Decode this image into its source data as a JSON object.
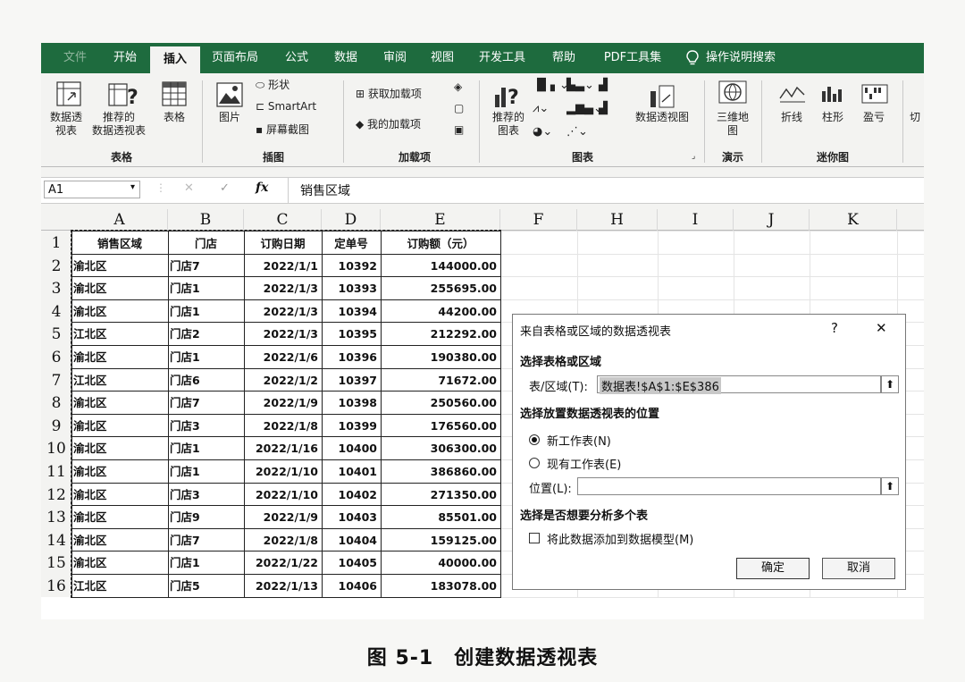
{
  "ribbon_tabs": [
    {
      "label": "文件"
    },
    {
      "label": "开始"
    },
    {
      "label": "插入"
    },
    {
      "label": "页面布局"
    },
    {
      "label": "公式"
    },
    {
      "label": "数据"
    },
    {
      "label": "审阅"
    },
    {
      "label": "视图"
    },
    {
      "label": "开发工具"
    },
    {
      "label": "帮助"
    },
    {
      "label": "PDF工具集"
    }
  ],
  "tell_me": "操作说明搜索",
  "ribbon": {
    "pivot_table_l1": "数据透",
    "pivot_table_l2": "视表",
    "recommended_pivot_l1": "推荐的",
    "recommended_pivot_l2": "数据透视表",
    "table": "表格",
    "group_tables": "表格",
    "pictures": "图片",
    "shapes": "形状",
    "smartart": "SmartArt",
    "screenshot": "屏幕截图",
    "group_illustrations": "插图",
    "get_addins": "获取加载项",
    "my_addins": "我的加载项",
    "group_addins": "加载项",
    "recommended_charts_l1": "推荐的",
    "recommended_charts_l2": "图表",
    "pivot_chart": "数据透视图",
    "group_charts": "图表",
    "map3d_l1": "三维地",
    "map3d_l2": "图",
    "group_tours": "演示",
    "sparkline_line": "折线",
    "sparkline_column": "柱形",
    "sparkline_winloss": "盈亏",
    "group_sparklines": "迷你图",
    "slicer_partial": "切"
  },
  "formula_bar": {
    "name_box": "A1",
    "fx": "fx",
    "value": "销售区域"
  },
  "columns": [
    "A",
    "B",
    "C",
    "D",
    "E",
    "F",
    "H",
    "I",
    "J",
    "K"
  ],
  "table": {
    "headers": [
      "销售区域",
      "门店",
      "订购日期",
      "定单号",
      "订购额（元）"
    ],
    "rows": [
      [
        "渝北区",
        "门店7",
        "2022/1/1",
        "10392",
        "144000.00"
      ],
      [
        "渝北区",
        "门店1",
        "2022/1/3",
        "10393",
        "255695.00"
      ],
      [
        "渝北区",
        "门店1",
        "2022/1/3",
        "10394",
        "44200.00"
      ],
      [
        "江北区",
        "门店2",
        "2022/1/3",
        "10395",
        "212292.00"
      ],
      [
        "渝北区",
        "门店1",
        "2022/1/6",
        "10396",
        "190380.00"
      ],
      [
        "江北区",
        "门店6",
        "2022/1/2",
        "10397",
        "71672.00"
      ],
      [
        "渝北区",
        "门店7",
        "2022/1/9",
        "10398",
        "250560.00"
      ],
      [
        "渝北区",
        "门店3",
        "2022/1/8",
        "10399",
        "176560.00"
      ],
      [
        "渝北区",
        "门店1",
        "2022/1/16",
        "10400",
        "306300.00"
      ],
      [
        "渝北区",
        "门店1",
        "2022/1/10",
        "10401",
        "386860.00"
      ],
      [
        "渝北区",
        "门店3",
        "2022/1/10",
        "10402",
        "271350.00"
      ],
      [
        "渝北区",
        "门店9",
        "2022/1/9",
        "10403",
        "85501.00"
      ],
      [
        "渝北区",
        "门店7",
        "2022/1/8",
        "10404",
        "159125.00"
      ],
      [
        "渝北区",
        "门店1",
        "2022/1/22",
        "10405",
        "40000.00"
      ],
      [
        "江北区",
        "门店5",
        "2022/1/13",
        "10406",
        "183078.00"
      ]
    ]
  },
  "row_numbers": [
    "1",
    "2",
    "3",
    "4",
    "5",
    "6",
    "7",
    "8",
    "9",
    "10",
    "11",
    "12",
    "13",
    "14",
    "15",
    "16"
  ],
  "dialog": {
    "title": "来自表格或区域的数据透视表",
    "help": "?",
    "close": "✕",
    "section_source": "选择表格或区域",
    "range_label": "表/区域(T):",
    "range_value": "数据表!$A$1:$E$386",
    "section_location": "选择放置数据透视表的位置",
    "opt_new": "新工作表(N)",
    "opt_existing": "现有工作表(E)",
    "location_label": "位置(L):",
    "location_value": "",
    "section_multi": "选择是否想要分析多个表",
    "add_model": "将此数据添加到数据模型(M)",
    "ok": "确定",
    "cancel": "取消"
  },
  "caption": "图 5-1　创建数据透视表"
}
